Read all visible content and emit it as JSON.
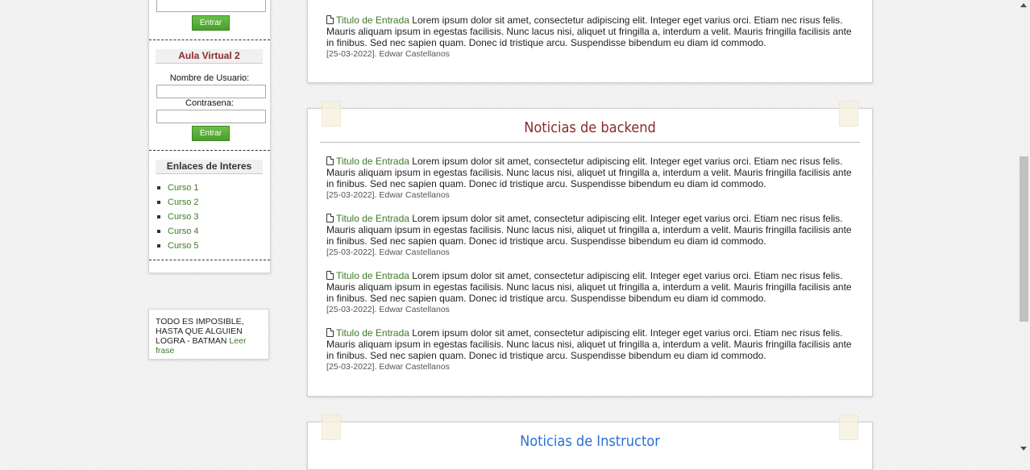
{
  "sidebar": {
    "login1_button": "Entrar",
    "aula2": {
      "title": "Aula Virtual 2",
      "username_label": "Nombre de Usuario:",
      "password_label": "Contrasena:",
      "button": "Entrar"
    },
    "links": {
      "title": "Enlaces de Interes",
      "items": [
        "Curso 1",
        "Curso 2",
        "Curso 3",
        "Curso 4",
        "Curso 5"
      ]
    }
  },
  "quote": {
    "text": "TODO ES IMPOSIBLE, HASTA QUE ALGUIEN LOGRA - BATMAN",
    "link": "Leer frase"
  },
  "panel_top": {
    "entries": [
      {
        "title": "Titulo de Entrada",
        "body": " Lorem ipsum dolor sit amet, consectetur adipiscing elit. Integer eget varius orci. Etiam nec risus felis. Mauris aliquam ipsum in egestas facilisis. Nunc lacus nisi, aliquet ut fringilla a, interdum a velit. Mauris fringilla facilisis ante in finibus. Sed nec sapien quam. Donec id tristique arcu. Suspendisse bibendum eu diam id commodo.",
        "meta": "[25-03-2022]. Edwar Castellanos"
      }
    ]
  },
  "panel_backend": {
    "title": "Noticias de backend",
    "entries": [
      {
        "title": "Titulo de Entrada",
        "body": " Lorem ipsum dolor sit amet, consectetur adipiscing elit. Integer eget varius orci. Etiam nec risus felis. Mauris aliquam ipsum in egestas facilisis. Nunc lacus nisi, aliquet ut fringilla a, interdum a velit. Mauris fringilla facilisis ante in finibus. Sed nec sapien quam. Donec id tristique arcu. Suspendisse bibendum eu diam id commodo.",
        "meta": "[25-03-2022]. Edwar Castellanos"
      },
      {
        "title": "Titulo de Entrada",
        "body": " Lorem ipsum dolor sit amet, consectetur adipiscing elit. Integer eget varius orci. Etiam nec risus felis. Mauris aliquam ipsum in egestas facilisis. Nunc lacus nisi, aliquet ut fringilla a, interdum a velit. Mauris fringilla facilisis ante in finibus. Sed nec sapien quam. Donec id tristique arcu. Suspendisse bibendum eu diam id commodo.",
        "meta": "[25-03-2022]. Edwar Castellanos"
      },
      {
        "title": "Titulo de Entrada",
        "body": " Lorem ipsum dolor sit amet, consectetur adipiscing elit. Integer eget varius orci. Etiam nec risus felis. Mauris aliquam ipsum in egestas facilisis. Nunc lacus nisi, aliquet ut fringilla a, interdum a velit. Mauris fringilla facilisis ante in finibus. Sed nec sapien quam. Donec id tristique arcu. Suspendisse bibendum eu diam id commodo.",
        "meta": "[25-03-2022]. Edwar Castellanos"
      },
      {
        "title": "Titulo de Entrada",
        "body": " Lorem ipsum dolor sit amet, consectetur adipiscing elit. Integer eget varius orci. Etiam nec risus felis. Mauris aliquam ipsum in egestas facilisis. Nunc lacus nisi, aliquet ut fringilla a, interdum a velit. Mauris fringilla facilisis ante in finibus. Sed nec sapien quam. Donec id tristique arcu. Suspendisse bibendum eu diam id commodo.",
        "meta": "[25-03-2022]. Edwar Castellanos"
      }
    ]
  },
  "panel_instructor": {
    "title": "Noticias de Instructor"
  },
  "colors": {
    "backend_title": "#8b2a2a",
    "instructor_title": "#2a6fd6",
    "aula_title": "#8b2a2a",
    "link": "#3f7a2a",
    "button": "#5aae37"
  }
}
